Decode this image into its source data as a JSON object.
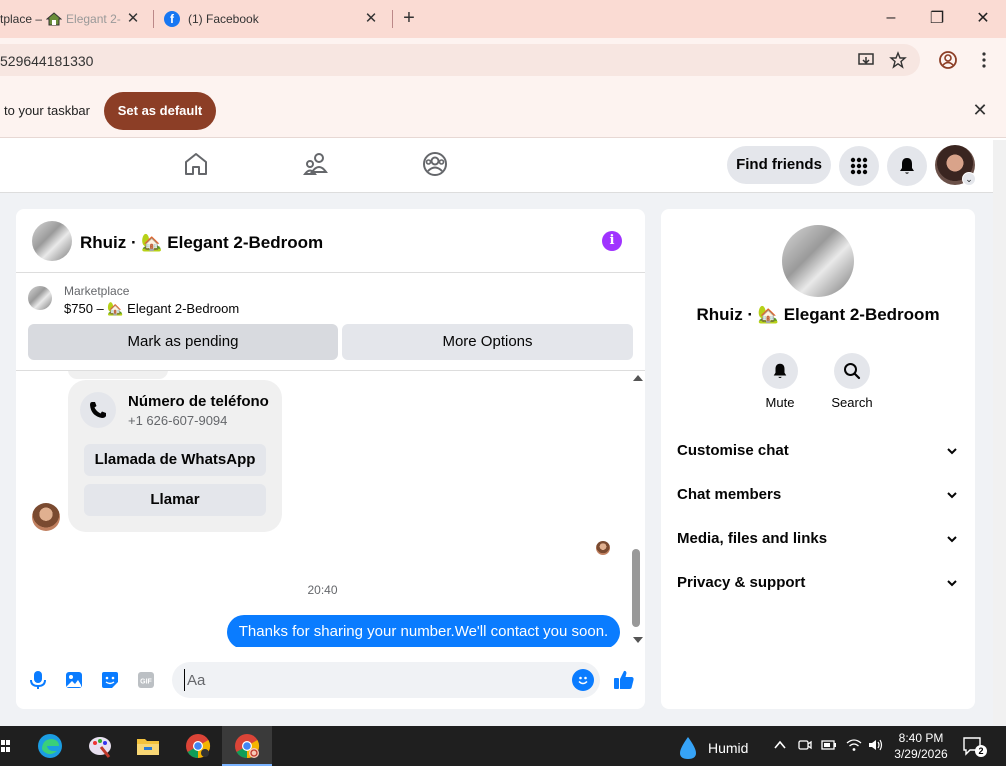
{
  "browser": {
    "tabs": [
      {
        "title": "tplace – ",
        "title_suffix": "Elegant 2-",
        "favicon": "house-icon"
      },
      {
        "title": "(1) Facebook",
        "favicon": "facebook-icon"
      }
    ],
    "url": "529644181330",
    "window_controls": {
      "minimize": "–",
      "maximize": "❐",
      "close": "✕"
    },
    "infobar": {
      "message": "to your taskbar",
      "button": "Set as default",
      "close": "✕"
    }
  },
  "fb_header": {
    "find_friends": "Find friends"
  },
  "chat": {
    "title": "Rhuiz · 🏡 Elegant 2-Bedroom",
    "marketplace": {
      "label": "Marketplace",
      "item": "$750 – 🏡 Elegant 2-Bedroom"
    },
    "buttons": {
      "pending": "Mark as pending",
      "more": "More Options"
    },
    "contact_card": {
      "title": "Número de teléfono",
      "number": "+1 626-607-9094",
      "whatsapp": "Llamada de WhatsApp",
      "call": "Llamar"
    },
    "timestamp": "20:40",
    "outgoing_message": "Thanks for sharing your number.We'll contact you soon.",
    "composer": {
      "placeholder": "Aa",
      "gif": "GIF"
    }
  },
  "side_panel": {
    "title": "Rhuiz · 🏡 Elegant 2-Bedroom",
    "actions": {
      "mute": "Mute",
      "search": "Search"
    },
    "sections": [
      "Customise chat",
      "Chat members",
      "Media, files and links",
      "Privacy & support"
    ]
  },
  "taskbar": {
    "weather": "Humid",
    "time": "8:40 PM",
    "date": "3/29/2026",
    "notifications": "2"
  },
  "colors": {
    "fb_blue": "#0a7cff",
    "set_default": "#8c3e26",
    "info_purple": "#a033ff"
  }
}
